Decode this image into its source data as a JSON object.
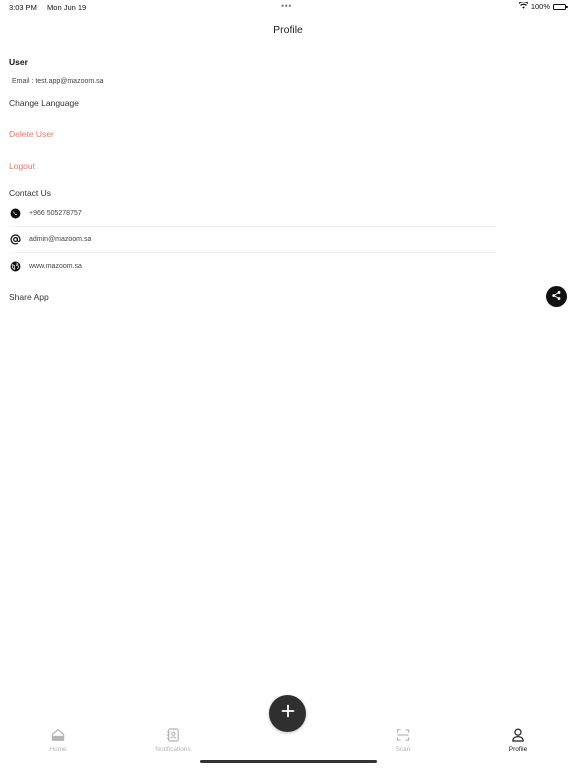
{
  "status_bar": {
    "time": "3:03 PM",
    "date": "Mon Jun 19",
    "battery": "100%"
  },
  "nav": {
    "title": "Profile"
  },
  "user": {
    "section_label": "User",
    "email": "Email : test.app@mazoom.sa"
  },
  "menu": {
    "change_language": "Change Language",
    "delete_user": "Delete User",
    "logout": "Logout",
    "contact_us": "Contact Us",
    "share_app": "Share App"
  },
  "contacts": [
    {
      "icon": "whatsapp-icon",
      "text": "+966 505278757"
    },
    {
      "icon": "at-icon",
      "text": "admin@mazoom.sa"
    },
    {
      "icon": "globe-icon",
      "text": "www.mazoom.sa"
    }
  ],
  "tabs": [
    {
      "label": "Home",
      "icon": "home-icon",
      "active": false
    },
    {
      "label": "Notifications",
      "icon": "contacts-book-icon",
      "active": false
    },
    {
      "label": "Scan",
      "icon": "scan-icon",
      "active": false
    },
    {
      "label": "Profile",
      "icon": "person-icon",
      "active": true
    }
  ],
  "colors": {
    "danger": "#e5766c",
    "fab": "#2f2f2f",
    "inactive_tab": "#b5b5b5"
  }
}
